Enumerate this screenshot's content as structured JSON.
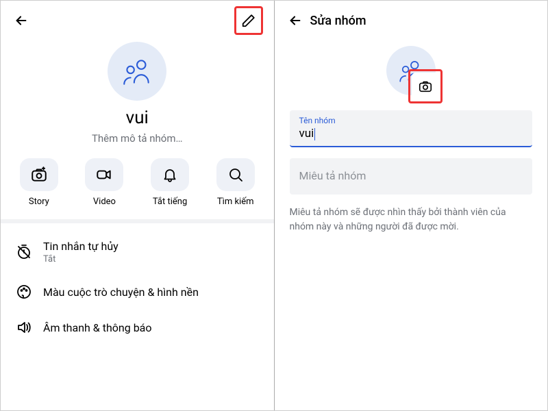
{
  "left": {
    "group_name": "vui",
    "group_desc": "Thêm mô tả nhóm…",
    "actions": {
      "story": "Story",
      "video": "Video",
      "mute": "Tắt tiếng",
      "search": "Tìm kiếm"
    },
    "settings": {
      "disappear_title": "Tin nhắn tự hủy",
      "disappear_sub": "Tắt",
      "color_title": "Màu cuộc trò chuyện & hình nền",
      "sounds_title": "Âm thanh & thông báo"
    }
  },
  "right": {
    "header_title": "Sửa nhóm",
    "name_label": "Tên nhóm",
    "name_value": "vui",
    "desc_placeholder": "Miêu tả nhóm",
    "hint": "Miêu tả nhóm sẽ được nhìn thấy bởi thành viên của nhóm này và những người đã được mời."
  }
}
